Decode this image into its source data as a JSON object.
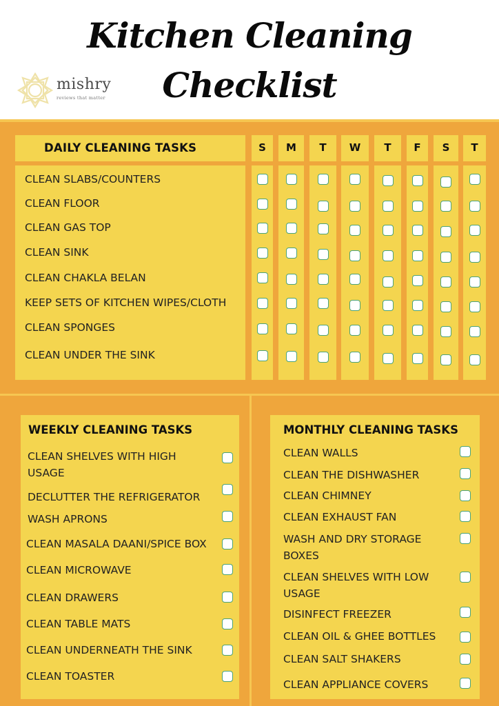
{
  "header": {
    "title_line1": "Kitchen Cleaning",
    "title_line2": "Checklist",
    "logo": {
      "icon": "star-ornament-logo-icon",
      "name": "mishry",
      "tagline": "reviews that matter"
    }
  },
  "colors": {
    "background": "#efa63c",
    "panel": "#f4d54f",
    "separator": "#f6c651",
    "checkbox_border": "#4aa37a",
    "checkbox_fill": "#ffffff"
  },
  "daily": {
    "title": "DAILY CLEANING TASKS",
    "days": [
      "S",
      "M",
      "T",
      "W",
      "T",
      "F",
      "S",
      "T"
    ],
    "tasks": [
      "CLEAN SLABS/COUNTERS",
      "CLEAN FLOOR",
      "CLEAN GAS TOP",
      "CLEAN SINK",
      "CLEAN CHAKLA BELAN",
      "KEEP SETS OF KITCHEN WIPES/CLOTH",
      "CLEAN SPONGES",
      "CLEAN UNDER THE SINK"
    ]
  },
  "weekly": {
    "title": "WEEKLY CLEANING TASKS",
    "tasks": [
      "CLEAN SHELVES WITH HIGH USAGE",
      "DECLUTTER THE REFRIGERATOR",
      "WASH APRONS",
      "CLEAN MASALA DAANI/SPICE BOX",
      "CLEAN MICROWAVE",
      "CLEAN DRAWERS",
      "CLEAN TABLE MATS",
      "CLEAN UNDERNEATH THE SINK",
      "CLEAN TOASTER"
    ]
  },
  "monthly": {
    "title": "MONTHLY CLEANING TASKS",
    "tasks": [
      "CLEAN WALLS",
      "CLEAN THE DISHWASHER",
      "CLEAN CHIMNEY",
      "CLEAN EXHAUST FAN",
      "WASH AND DRY STORAGE BOXES",
      "CLEAN SHELVES WITH LOW USAGE",
      "DISINFECT FREEZER",
      "CLEAN OIL & GHEE BOTTLES",
      "CLEAN SALT SHAKERS",
      "CLEAN APPLIANCE COVERS"
    ]
  }
}
